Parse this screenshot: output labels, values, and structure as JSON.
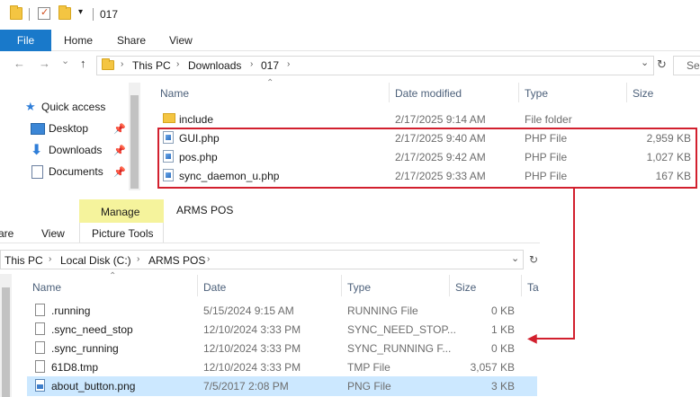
{
  "window1": {
    "title": "017",
    "ribbon_tabs": [
      "File",
      "Home",
      "Share",
      "View"
    ],
    "nav": {
      "back": "←",
      "forward": "→",
      "recent": "⌄",
      "up": "↑",
      "breadcrumbs": [
        "This PC",
        "Downloads",
        "017"
      ],
      "dropdown": "⌄",
      "refresh": "↻",
      "search_placeholder": "Sea"
    },
    "sidebar": [
      {
        "label": "Quick access",
        "icon": "star-icon"
      },
      {
        "label": "Desktop",
        "icon": "desktop-icon",
        "pinned": true
      },
      {
        "label": "Downloads",
        "icon": "download-icon",
        "pinned": true
      },
      {
        "label": "Documents",
        "icon": "documents-icon",
        "pinned": true
      }
    ],
    "columns": [
      "Name",
      "Date modified",
      "Type",
      "Size"
    ],
    "files": [
      {
        "name": "include",
        "date": "2/17/2025 9:14 AM",
        "type": "File folder",
        "size": "",
        "icon": "folder-icon"
      },
      {
        "name": "GUI.php",
        "date": "2/17/2025 9:40 AM",
        "type": "PHP File",
        "size": "2,959 KB",
        "icon": "php-file-icon"
      },
      {
        "name": "pos.php",
        "date": "2/17/2025 9:42 AM",
        "type": "PHP File",
        "size": "1,027 KB",
        "icon": "php-file-icon"
      },
      {
        "name": "sync_daemon_u.php",
        "date": "2/17/2025 9:33 AM",
        "type": "PHP File",
        "size": "167 KB",
        "icon": "php-file-icon"
      }
    ]
  },
  "window2": {
    "title": "ARMS POS",
    "context_tab": "Manage",
    "context_group": "Picture Tools",
    "ribbon_tabs": [
      "are",
      "View"
    ],
    "breadcrumbs": [
      "This PC",
      "Local Disk (C:)",
      "ARMS POS"
    ],
    "columns": [
      "Name",
      "Date",
      "Type",
      "Size",
      "Ta"
    ],
    "files": [
      {
        "name": ".running",
        "date": "5/15/2024 9:15 AM",
        "type": "RUNNING File",
        "size": "0 KB"
      },
      {
        "name": ".sync_need_stop",
        "date": "12/10/2024 3:33 PM",
        "type": "SYNC_NEED_STOP...",
        "size": "1 KB"
      },
      {
        "name": ".sync_running",
        "date": "12/10/2024 3:33 PM",
        "type": "SYNC_RUNNING F...",
        "size": "0 KB"
      },
      {
        "name": "61D8.tmp",
        "date": "12/10/2024 3:33 PM",
        "type": "TMP File",
        "size": "3,057 KB"
      },
      {
        "name": "about_button.png",
        "date": "7/5/2017 2:08 PM",
        "type": "PNG File",
        "size": "3 KB"
      }
    ]
  },
  "annotation_color": "#d2202e"
}
